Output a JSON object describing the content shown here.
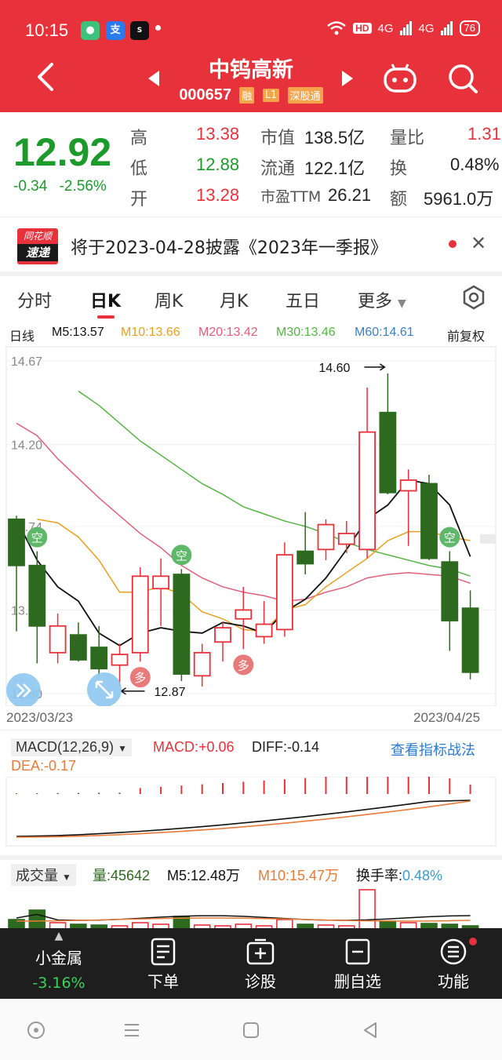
{
  "status_bar": {
    "time": "10:15",
    "battery": "76",
    "hd": "HD",
    "net1": "4G",
    "net2": "4G"
  },
  "header": {
    "title": "中钨高新",
    "code": "000657",
    "tags": [
      "融",
      "L1",
      "深股通"
    ]
  },
  "quote": {
    "price": "12.92",
    "change": "-0.34",
    "change_pct": "-2.56%",
    "high_label": "高",
    "high": "13.38",
    "low_label": "低",
    "low": "12.88",
    "open_label": "开",
    "open": "13.28",
    "mcap_label": "市值",
    "mcap": "138.5亿",
    "float_label": "流通",
    "float": "122.1亿",
    "pe_label": "市盈TTM",
    "pe": "26.21",
    "vr_label": "量比",
    "vr": "1.31",
    "turn_label": "换",
    "turn": "0.48%",
    "amt_label": "额",
    "amt": "5961.0万"
  },
  "notice": {
    "logo_top": "同花顺",
    "logo_bottom": "速递",
    "text": "将于2023-04-28披露《2023年一季报》"
  },
  "tabs": [
    "分时",
    "日K",
    "周K",
    "月K",
    "五日",
    "更多"
  ],
  "ma_legend": {
    "type": "日线",
    "m5": "M5:13.57",
    "m10": "M10:13.66",
    "m20": "M20:13.42",
    "m30": "M30:13.46",
    "m60": "M60:14.61",
    "adjust": "前复权"
  },
  "colors": {
    "up": "#e8323b",
    "down": "#2d6a1f",
    "m5": "#111111",
    "m10": "#e8a020",
    "m20": "#e0607a",
    "m30": "#55b544",
    "m60": "#3b7fc4"
  },
  "chart_data": {
    "type": "candlestick",
    "y_axis_labels": [
      "14.67",
      "14.20",
      "13.74",
      "13.27",
      "12.80"
    ],
    "ylim": [
      12.8,
      14.67
    ],
    "start_date": "2023/03/23",
    "end_date": "2023/04/25",
    "annotations": {
      "max": "14.60",
      "min": "12.87",
      "buy_signal": "多",
      "sell_signal": "空"
    },
    "candles": [
      {
        "o": 13.78,
        "h": 13.8,
        "l": 13.15,
        "c": 13.52
      },
      {
        "o": 13.52,
        "h": 13.6,
        "l": 12.97,
        "c": 13.18
      },
      {
        "o": 13.03,
        "h": 13.25,
        "l": 12.97,
        "c": 13.18
      },
      {
        "o": 13.13,
        "h": 13.2,
        "l": 12.98,
        "c": 12.99
      },
      {
        "o": 13.06,
        "h": 13.18,
        "l": 12.9,
        "c": 12.94
      },
      {
        "o": 12.96,
        "h": 13.08,
        "l": 12.84,
        "c": 13.02
      },
      {
        "o": 13.03,
        "h": 13.51,
        "l": 12.98,
        "c": 13.46
      },
      {
        "o": 13.39,
        "h": 13.56,
        "l": 13.18,
        "c": 13.46
      },
      {
        "o": 13.47,
        "h": 13.5,
        "l": 12.87,
        "c": 12.91
      },
      {
        "o": 12.9,
        "h": 13.08,
        "l": 12.84,
        "c": 13.03
      },
      {
        "o": 13.09,
        "h": 13.2,
        "l": 12.98,
        "c": 13.17
      },
      {
        "o": 13.22,
        "h": 13.4,
        "l": 13.05,
        "c": 13.27
      },
      {
        "o": 13.12,
        "h": 13.32,
        "l": 13.08,
        "c": 13.19
      },
      {
        "o": 13.16,
        "h": 13.65,
        "l": 13.12,
        "c": 13.58
      },
      {
        "o": 13.6,
        "h": 13.82,
        "l": 13.47,
        "c": 13.53
      },
      {
        "o": 13.61,
        "h": 13.78,
        "l": 13.55,
        "c": 13.75
      },
      {
        "o": 13.64,
        "h": 13.77,
        "l": 13.59,
        "c": 13.7
      },
      {
        "o": 13.61,
        "h": 14.52,
        "l": 13.56,
        "c": 14.27
      },
      {
        "o": 14.38,
        "h": 14.6,
        "l": 13.92,
        "c": 13.93
      },
      {
        "o": 13.94,
        "h": 14.06,
        "l": 13.63,
        "c": 14.0
      },
      {
        "o": 13.98,
        "h": 14.03,
        "l": 13.55,
        "c": 13.56
      },
      {
        "o": 13.54,
        "h": 13.6,
        "l": 13.04,
        "c": 13.21
      },
      {
        "o": 13.28,
        "h": 13.38,
        "l": 12.88,
        "c": 12.92
      }
    ],
    "m5": [
      13.78,
      13.55,
      13.4,
      13.32,
      13.14,
      13.07,
      13.14,
      13.17,
      13.15,
      13.14,
      13.2,
      13.18,
      13.14,
      13.26,
      13.33,
      13.45,
      13.61,
      13.78,
      13.86,
      14.0,
      13.98,
      13.86,
      13.57
    ],
    "m10": [
      null,
      13.78,
      13.76,
      13.68,
      13.55,
      13.37,
      13.37,
      13.4,
      13.36,
      13.26,
      13.22,
      13.16,
      13.15,
      13.27,
      13.3,
      13.4,
      13.48,
      13.56,
      13.66,
      13.71,
      13.71,
      13.68,
      13.66
    ],
    "m20": [
      14.32,
      14.25,
      14.12,
      14.01,
      13.9,
      13.8,
      13.7,
      13.62,
      13.52,
      13.45,
      13.4,
      13.37,
      13.35,
      13.32,
      13.33,
      13.37,
      13.4,
      13.45,
      13.47,
      13.48,
      13.47,
      13.46,
      13.42
    ],
    "m30": [
      null,
      null,
      null,
      14.5,
      14.42,
      14.32,
      14.22,
      14.14,
      14.06,
      13.98,
      13.92,
      13.85,
      13.81,
      13.77,
      13.74,
      13.7,
      13.65,
      13.61,
      13.58,
      13.55,
      13.52,
      13.5,
      13.46
    ]
  },
  "macd": {
    "selector": "MACD(12,26,9)",
    "macd": "MACD:+0.06",
    "diff": "DIFF:-0.14",
    "dea": "DEA:-0.17",
    "link": "查看指标战法"
  },
  "volume": {
    "selector": "成交量",
    "vol": "量:45642",
    "m5": "M5:12.48万",
    "m10": "M10:15.47万",
    "turnover_label": "换手率:",
    "turnover": "0.48%"
  },
  "toolbar": {
    "metal_name": "小金属",
    "metal_chg": "-3.16%",
    "order": "下单",
    "diag": "诊股",
    "remove": "删自选",
    "func": "功能"
  }
}
